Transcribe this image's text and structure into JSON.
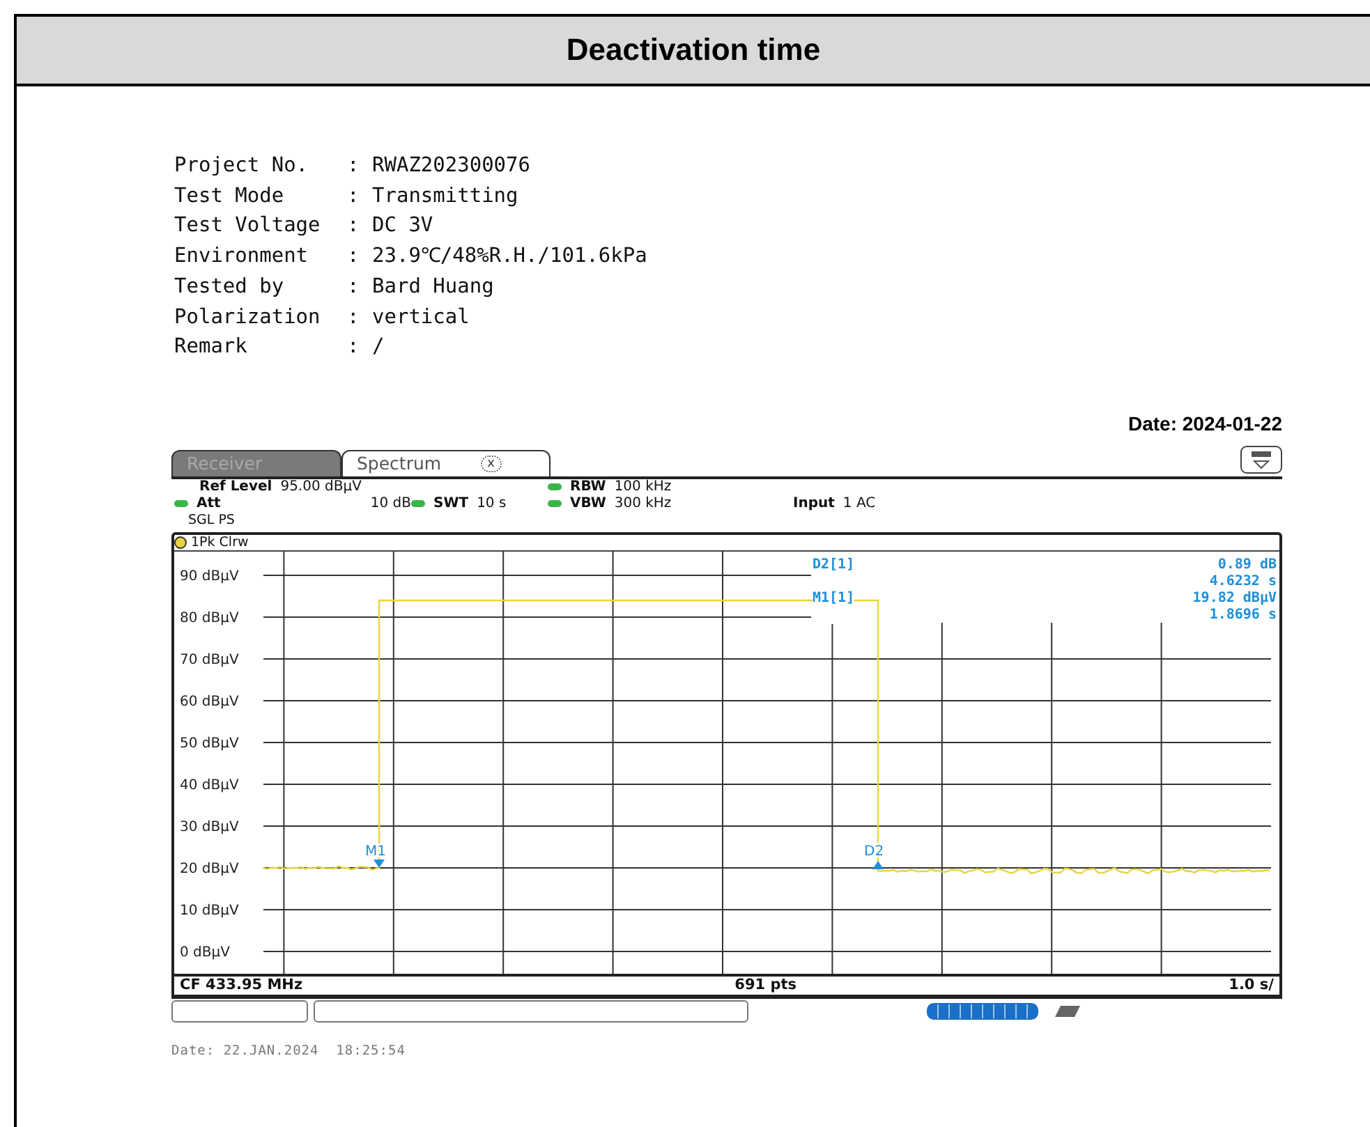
{
  "title": "Deactivation time",
  "info": [
    {
      "label": "Project No.",
      "value": "RWAZ202300076"
    },
    {
      "label": "Test Mode",
      "value": "Transmitting"
    },
    {
      "label": "Test Voltage",
      "value": "DC 3V"
    },
    {
      "label": "Environment",
      "value": "23.9℃/48%R.H./101.6kPa"
    },
    {
      "label": "Tested by",
      "value": "Bard Huang"
    },
    {
      "label": "Polarization",
      "value": "vertical"
    },
    {
      "label": "Remark",
      "value": "/"
    }
  ],
  "separator": ":",
  "date": "Date: 2024-01-22",
  "analyzer": {
    "tabs": [
      {
        "label": "Receiver",
        "selected": false
      },
      {
        "label": "Spectrum",
        "selected": true
      }
    ],
    "tab_close": "x",
    "settings": [
      [
        {
          "label": "Ref Level",
          "value": "95.00 dBµV",
          "indicator": false
        },
        {
          "label": "Att",
          "value": "10 dB",
          "indicator": true
        }
      ],
      [
        {
          "label": "SWT",
          "value": "10 s",
          "indicator": true
        }
      ],
      [
        {
          "label": "RBW",
          "value": "100 kHz",
          "indicator": true
        },
        {
          "label": "VBW",
          "value": "300 kHz",
          "indicator": true
        }
      ],
      [
        {
          "label": "Input",
          "value": "1 AC",
          "indicator": false
        }
      ]
    ],
    "sweep_mode": "SGL PS",
    "trace_label": "1Pk Clrw",
    "y_axis_labels": [
      "90 dBµV",
      "80 dBµV",
      "70 dBµV",
      "60 dBµV",
      "50 dBµV",
      "40 dBµV",
      "30 dBµV",
      "20 dBµV",
      "10 dBµV",
      "0 dBµV"
    ],
    "markers": [
      {
        "label": "D2[1]",
        "values": [
          "0.89 dB",
          "4.6232 s"
        ]
      },
      {
        "label": "M1[1]",
        "values": [
          "19.82 dBµV",
          "1.8696 s"
        ]
      }
    ],
    "trace_markers": [
      {
        "label": "M1",
        "kind": "down"
      },
      {
        "label": "D2",
        "kind": "up"
      }
    ],
    "footer": {
      "center_frequency": "CF 433.95 MHz",
      "points": "691 pts",
      "sweep_scale": "1.0 s/"
    }
  },
  "capture_time": "Date: 22.JAN.2024  18:25:54"
}
